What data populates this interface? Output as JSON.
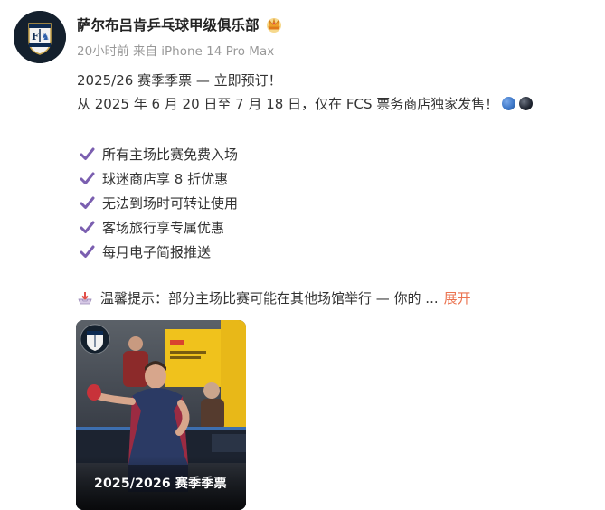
{
  "account": {
    "name": "萨尔布吕肯乒乓球甲级俱乐部",
    "meta": "20小时前 来自 iPhone 14 Pro Max",
    "avatar_icon": "fcs-club-logo",
    "badge_icon": "crown-icon"
  },
  "post": {
    "line1": "2025/26 赛季季票 — 立即预订！",
    "line2": "从 2025 年 6 月 20 日至 7 月 18 日，仅在 FCS 票务商店独家发售！",
    "line2_dots": [
      "#3e78c8",
      "#1e2430"
    ],
    "benefits": [
      "所有主场比赛免费入场",
      "球迷商店享 8 折优惠",
      "无法到场时可转让使用",
      "客场旅行享专属优惠",
      "每月电子简报推送"
    ],
    "tip_text": "温馨提示：部分主场比赛可能在其他场馆举行 — 你的 ...",
    "expand_label": "展开"
  },
  "image_card": {
    "caption": "2025/2026 赛季季票"
  },
  "colors": {
    "check": "#7b5fb0",
    "link": "#eb7350",
    "meta": "#999999"
  }
}
